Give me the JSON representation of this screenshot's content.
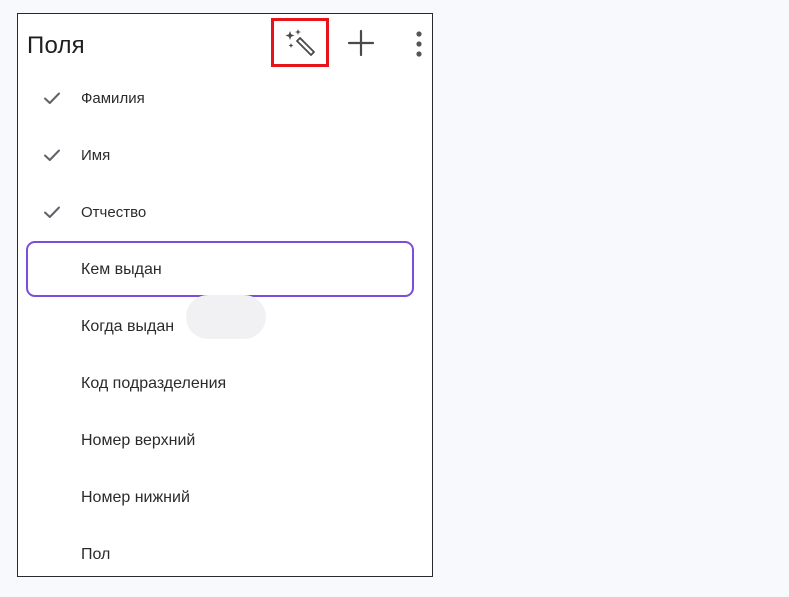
{
  "panel": {
    "title": "Поля",
    "toolbar": {
      "magic_icon": "magic-wand-icon",
      "add_icon": "plus-icon",
      "more_icon": "more-vertical-icon",
      "highlight_color": "#e8141b"
    }
  },
  "fields": [
    {
      "label": "Фамилия",
      "checked": true
    },
    {
      "label": "Имя",
      "checked": true
    },
    {
      "label": "Отчество",
      "checked": true
    },
    {
      "label": "Кем выдан",
      "checked": false,
      "focused": true
    },
    {
      "label": "Когда выдан",
      "checked": false
    },
    {
      "label": "Код подразделения",
      "checked": false
    },
    {
      "label": "Номер верхний",
      "checked": false
    },
    {
      "label": "Номер нижний",
      "checked": false
    },
    {
      "label": "Пол",
      "checked": false
    }
  ],
  "colors": {
    "focus_ring": "#7c4ddb",
    "text": "#2b2b2b",
    "check": "#5f6368"
  }
}
